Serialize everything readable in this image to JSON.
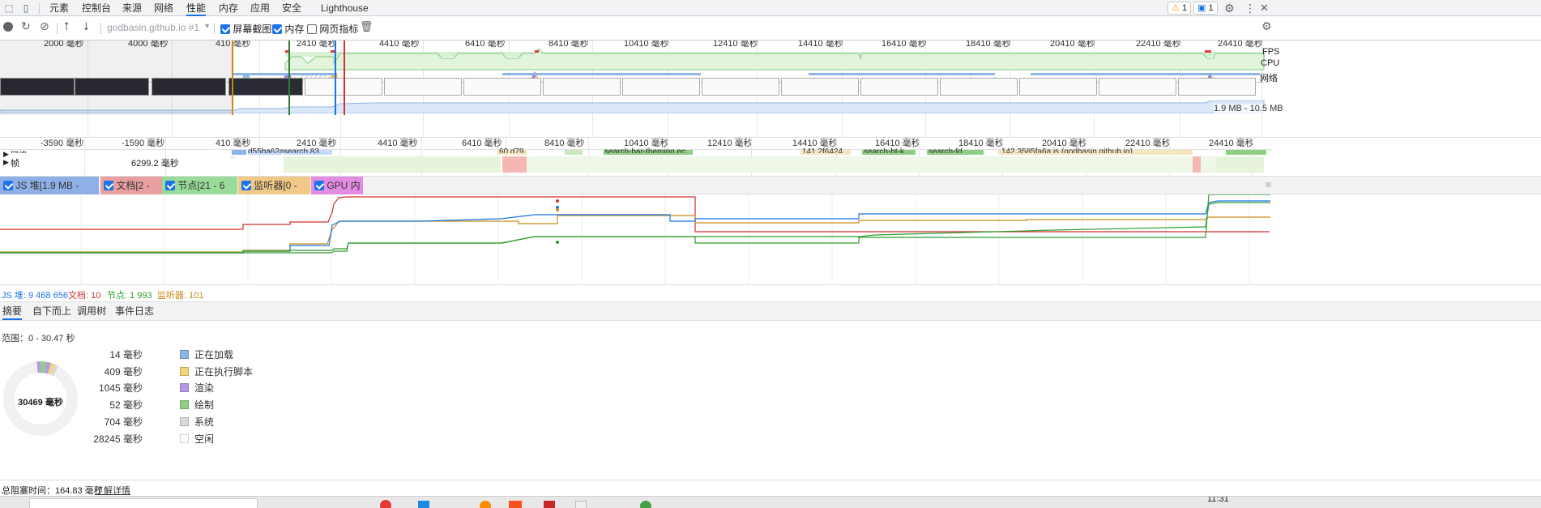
{
  "tabs": [
    "元素",
    "控制台",
    "来源",
    "网络",
    "性能",
    "内存",
    "应用",
    "安全",
    "Lighthouse"
  ],
  "active_tab": "性能",
  "badges": {
    "warnings": "1",
    "messages": "1"
  },
  "toolbar": {
    "url_select": "godbasin.github.io #1",
    "screenshots_label": "屏幕截图",
    "memory_label": "内存",
    "web_vitals_label": "网页指标"
  },
  "overview": {
    "ruler_labels": [
      "2000 毫秒",
      "4000 毫秒",
      "410 毫秒",
      "2410 毫秒",
      "4410 毫秒",
      "6410 毫秒",
      "8410 毫秒",
      "10410 毫秒",
      "12410 毫秒",
      "14410 毫秒",
      "16410 毫秒",
      "18410 毫秒",
      "20410 毫秒",
      "22410 毫秒",
      "24410 毫秒"
    ],
    "fps_label": "FPS",
    "cpu_label": "CPU",
    "net_label": "网络",
    "heap_range": "1.9 MB - 10.5 MB"
  },
  "flame": {
    "ruler_labels": [
      "-3590 毫秒",
      "-1590 毫秒",
      "410 毫秒",
      "2410 毫秒",
      "4410 毫秒",
      "6410 毫秒",
      "8410 毫秒",
      "10410 毫秒",
      "12410 毫秒",
      "14410 毫秒",
      "16410 毫秒",
      "18410 毫秒",
      "20410 毫秒",
      "22410 毫秒",
      "24410 毫秒"
    ],
    "network_label": "网络",
    "frames_label": "帧",
    "frames_value": "6299.2 毫秒",
    "snippets": [
      "d55ba62a…",
      "search.83…",
      "60.d79…",
      "search-bar-theming.ec…",
      "141.2f6424…",
      "search-bt-k…",
      "search-fd…",
      "142.3585fa6a.js (godbasin.github.io)"
    ]
  },
  "legend": [
    {
      "label": "JS 堆[1.9 MB - 10.5 MB]",
      "color": "#1a73e8",
      "bg": "#8fb0e6"
    },
    {
      "label": "文档[2 - 10]",
      "color": "#d32f2f",
      "bg": "#e8a0a0"
    },
    {
      "label": "节点[21 - 6 210]",
      "color": "#2e9d2e",
      "bg": "#99dc99"
    },
    {
      "label": "监听器[0 - 125]",
      "color": "#c98a1a",
      "bg": "#f0c988"
    },
    {
      "label": "GPU 内存",
      "color": "#9c27b0",
      "bg": "#e48ce4"
    }
  ],
  "counters": {
    "js_heap": "JS 堆: 9 468 656",
    "documents": "文档: 10",
    "nodes": "节点: 1 993",
    "listeners": "监听器: 101"
  },
  "bottom_tabs": [
    "摘要",
    "自下而上",
    "调用树",
    "事件日志"
  ],
  "summary": {
    "range": "范围：0 - 30.47 秒",
    "total": "30469 毫秒",
    "rows": [
      {
        "value": "14 毫秒",
        "label": "正在加载",
        "color": "#8eb5e8"
      },
      {
        "value": "409 毫秒",
        "label": "正在执行脚本",
        "color": "#f2d57a"
      },
      {
        "value": "1045 毫秒",
        "label": "渲染",
        "color": "#b598e6"
      },
      {
        "value": "52 毫秒",
        "label": "绘制",
        "color": "#8fcf84"
      },
      {
        "value": "704 毫秒",
        "label": "系统",
        "color": "#d9d9d9"
      },
      {
        "value": "28245 毫秒",
        "label": "空闲",
        "color": "#ffffff"
      }
    ]
  },
  "footer": {
    "blocking_label": "总阻塞时间：164.83 毫秒",
    "learn_more": "了解详情"
  },
  "taskbar": {
    "clock": "11:31"
  }
}
